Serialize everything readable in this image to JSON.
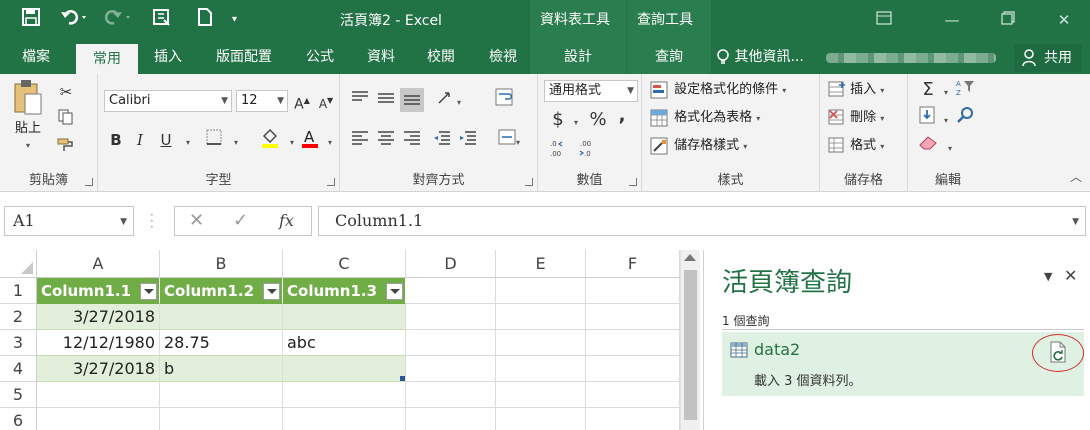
{
  "window": {
    "title": "活頁簿2 - Excel",
    "context_tabs": [
      "資料表工具",
      "查詢工具"
    ]
  },
  "ribbon_tabs": {
    "file": "檔案",
    "home": "常用",
    "insert": "插入",
    "page_layout": "版面配置",
    "formulas": "公式",
    "data": "資料",
    "review": "校閱",
    "view": "檢視",
    "design": "設計",
    "query": "查詢",
    "tell_me": "其他資訊...",
    "share": "共用"
  },
  "clipboard": {
    "paste": "貼上",
    "label": "剪貼簿"
  },
  "font": {
    "name": "Calibri",
    "size": "12",
    "label": "字型",
    "bold": "B",
    "italic": "I",
    "underline": "U"
  },
  "alignment": {
    "label": "對齊方式"
  },
  "number": {
    "format": "通用格式",
    "currency": "$",
    "percent": "%",
    "comma": ",",
    "label": "數值"
  },
  "styles": {
    "conditional_formatting": "設定格式化的條件",
    "format_as_table": "格式化為表格",
    "cell_styles": "儲存格樣式",
    "label": "樣式"
  },
  "cells": {
    "insert": "插入",
    "delete": "刪除",
    "format": "格式",
    "label": "儲存格"
  },
  "editing": {
    "label": "編輯"
  },
  "formula_bar": {
    "name_box": "A1",
    "content": "Column1.1",
    "fx": "fx"
  },
  "sheet": {
    "columns": [
      "A",
      "B",
      "C",
      "D",
      "E",
      "F"
    ],
    "rows": [
      "1",
      "2",
      "3",
      "4",
      "5",
      "6"
    ],
    "header": [
      "Column1.1",
      "Column1.2",
      "Column1.3"
    ],
    "data": [
      [
        "3/27/2018",
        "",
        ""
      ],
      [
        "12/12/1980",
        "28.75",
        "abc"
      ],
      [
        "3/27/2018",
        "b",
        ""
      ]
    ]
  },
  "query_pane": {
    "title": "活頁簿查詢",
    "count": "1 個查詢",
    "query_name": "data2",
    "query_desc": "載入 3 個資料列。"
  },
  "colors": {
    "accent": "#217346",
    "table_header": "#70ad47",
    "table_band": "#e2efda",
    "highlight_ring": "#d32f2f"
  }
}
